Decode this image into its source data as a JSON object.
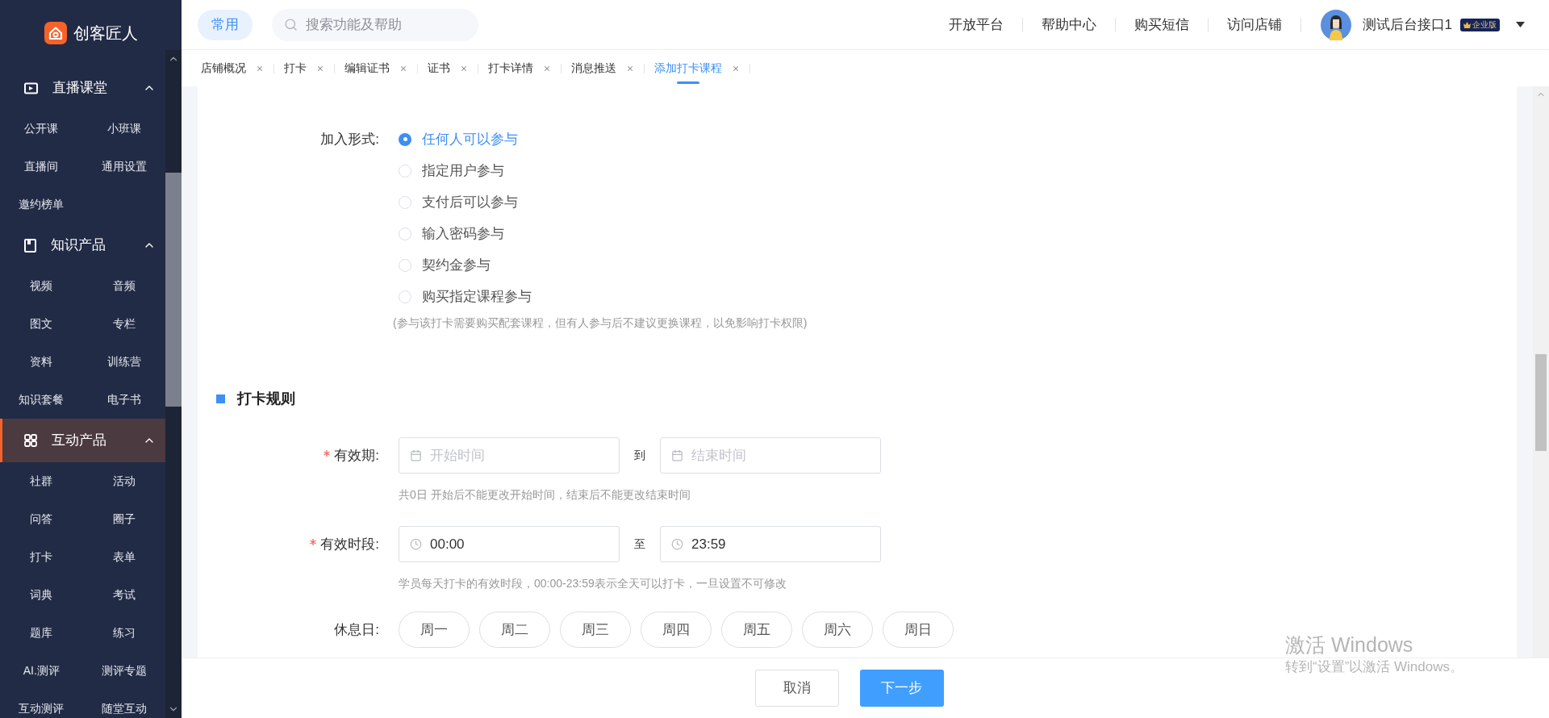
{
  "sidebar": {
    "logo": "创客匠人",
    "groups": [
      {
        "title": "直播课堂",
        "expanded": true,
        "selected": false,
        "items": [
          "公开课",
          "小班课",
          "直播间",
          "通用设置",
          "邀约榜单"
        ]
      },
      {
        "title": "知识产品",
        "expanded": true,
        "selected": false,
        "items": [
          "视频",
          "音频",
          "图文",
          "专栏",
          "资料",
          "训练营",
          "知识套餐",
          "电子书"
        ]
      },
      {
        "title": "互动产品",
        "expanded": true,
        "selected": true,
        "items": [
          "社群",
          "活动",
          "问答",
          "圈子",
          "打卡",
          "表单",
          "词典",
          "考试",
          "题库",
          "练习",
          "AI.测评",
          "测评专题",
          "互动测评",
          "随堂互动"
        ]
      }
    ]
  },
  "topbar": {
    "favorites": "常用",
    "search": {
      "placeholder": "搜索功能及帮助"
    },
    "links": [
      "开放平台",
      "帮助中心",
      "购买短信",
      "访问店铺"
    ],
    "user": {
      "name": "测试后台接口1",
      "badge": "企业版"
    }
  },
  "tabs": [
    {
      "label": "店铺概况",
      "selected": false
    },
    {
      "label": "打卡",
      "selected": false
    },
    {
      "label": "编辑证书",
      "selected": false
    },
    {
      "label": "证书",
      "selected": false
    },
    {
      "label": "打卡详情",
      "selected": false
    },
    {
      "label": "消息推送",
      "selected": false
    },
    {
      "label": "添加打卡课程",
      "selected": true
    }
  ],
  "form": {
    "join": {
      "label": "加入形式:",
      "options": [
        {
          "label": "任何人可以参与",
          "selected": true
        },
        {
          "label": "指定用户参与",
          "selected": false
        },
        {
          "label": "支付后可以参与",
          "selected": false
        },
        {
          "label": "输入密码参与",
          "selected": false
        },
        {
          "label": "契约金参与",
          "selected": false
        },
        {
          "label": "购买指定课程参与",
          "selected": false
        }
      ],
      "hint": "(参与该打卡需要购买配套课程，但有人参与后不建议更换课程，以免影响打卡权限)"
    },
    "section_title": "打卡规则",
    "ranges": [
      {
        "kind": "date",
        "required": true,
        "label": "有效期:",
        "start": {
          "placeholder": "开始时间"
        },
        "separator": "到",
        "end": {
          "placeholder": "结束时间"
        },
        "hint": "共0日 开始后不能更改开始时间，结束后不能更改结束时间"
      },
      {
        "kind": "time",
        "required": true,
        "label": "有效时段:",
        "start": {
          "value": "00:00"
        },
        "separator": "至",
        "end": {
          "value": "23:59"
        },
        "hint": "学员每天打卡的有效时段，00:00-23:59表示全天可以打卡，一旦设置不可修改"
      }
    ],
    "rest_days": {
      "label": "休息日:",
      "days": [
        {
          "label": "周一",
          "selected": false
        },
        {
          "label": "周二",
          "selected": false
        },
        {
          "label": "周三",
          "selected": false
        },
        {
          "label": "周四",
          "selected": false
        },
        {
          "label": "周五",
          "selected": false
        },
        {
          "label": "周六",
          "selected": false
        },
        {
          "label": "周日",
          "selected": false
        }
      ]
    }
  },
  "footer": {
    "buttons": [
      {
        "label": "取消",
        "kind": "secondary"
      },
      {
        "label": "下一步",
        "kind": "primary"
      }
    ]
  },
  "os_notice": {
    "title": "激活 Windows",
    "subtitle": "转到“设置”以激活 Windows。"
  }
}
